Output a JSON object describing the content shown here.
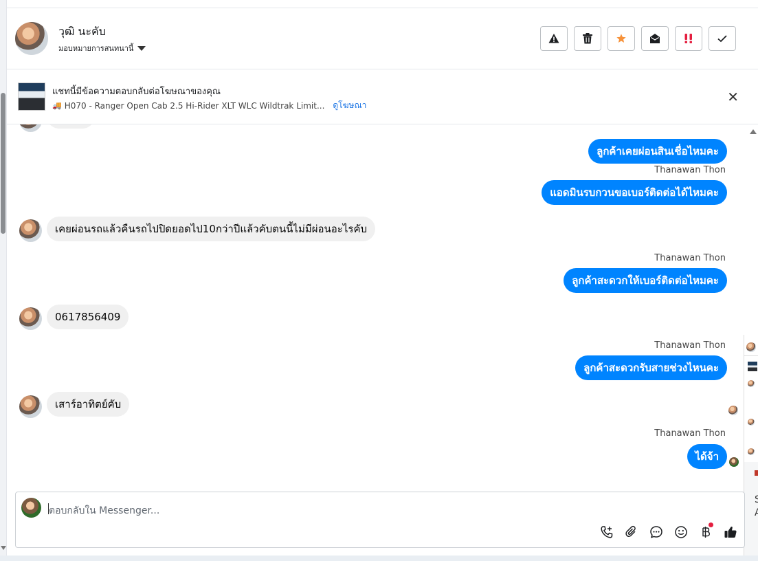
{
  "header": {
    "name": "วุฒิ นะคับ",
    "assign_label": "มอบหมายการสนทนานี้"
  },
  "toolbar": {
    "spam_label": "spam",
    "delete_label": "delete",
    "star_label": "star",
    "unread_label": "mark unread",
    "important_label": "important",
    "done_label": "done"
  },
  "banner": {
    "title": "แชทนี้มีข้อความตอบกลับต่อโฆษณาของคุณ",
    "ad_text": "H070 - Ranger Open Cab 2.5 Hi-Rider XLT WLC Wildtrak Limit...",
    "link": "ดูโฆษณา"
  },
  "messages": {
    "out1": "ลูกค้าเคยผ่อนสินเชื่อไหมคะ",
    "sender1": "Thanawan Thon",
    "out2": "แอดมินรบกวนขอเบอร์ติดต่อได้ไหมคะ",
    "in1": "เคยผ่อนรถแล้วคืนรถไปปิดยอดไป10กว่าปีแล้วคับตนนี้ไม่มีผ่อนอะไรคับ",
    "sender2": "Thanawan Thon",
    "out3": "ลูกค้าสะดวกให้เบอร์ติดต่อไหมคะ",
    "in2": "0617856409",
    "sender3": "Thanawan Thon",
    "out4": "ลูกค้าสะดวกรับสายช่วงไหนคะ",
    "in3": "เสาร์อาทิตย์คับ",
    "sender4": "Thanawan Thon",
    "out5": "ได้จ้า"
  },
  "side_panel": {
    "letter_s": "S",
    "letter_a": "A"
  },
  "composer": {
    "placeholder": "ตอบกลับใน Messenger..."
  },
  "colors": {
    "accent": "#0084ff",
    "incoming_bg": "#f0f0f0",
    "link": "#1b74e4",
    "star": "#f7923a",
    "alert": "#e41e3f"
  }
}
